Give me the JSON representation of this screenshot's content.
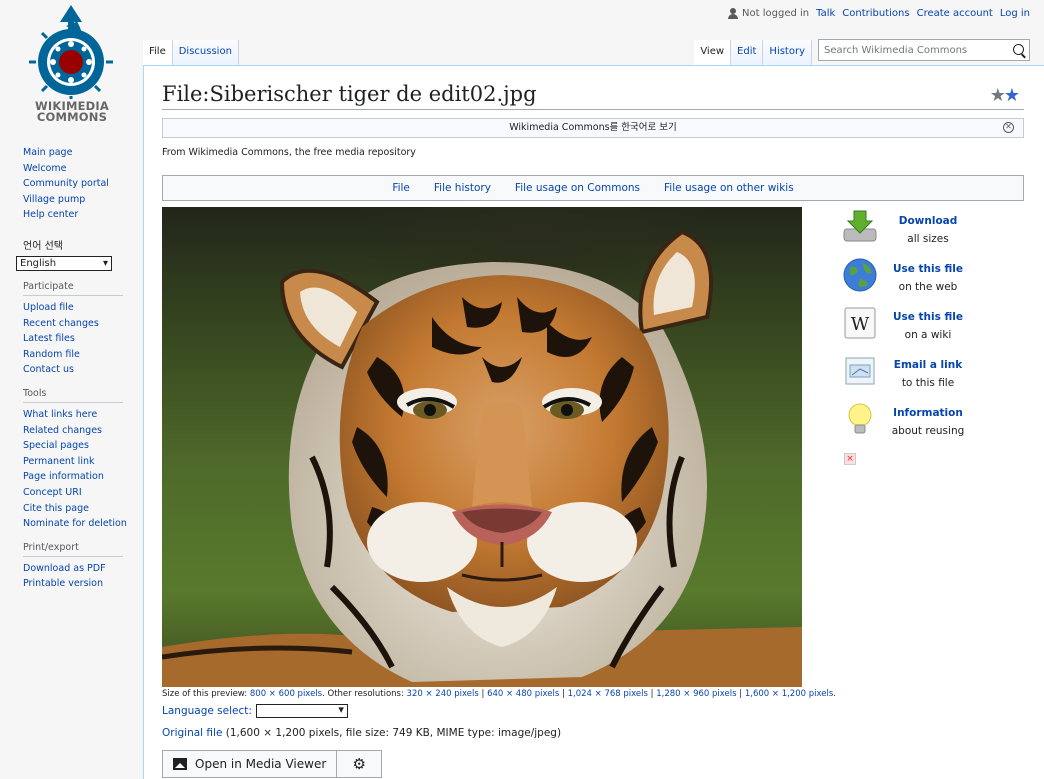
{
  "personal": {
    "not_logged_in": "Not logged in",
    "talk": "Talk",
    "contributions": "Contributions",
    "create_account": "Create account",
    "log_in": "Log in"
  },
  "logo": {
    "line1": "WIKIMEDIA",
    "line2": "COMMONS",
    "icon": "wikimedia-commons-logo"
  },
  "sidebar": {
    "nav": [
      "Main page",
      "Welcome",
      "Community portal",
      "Village pump",
      "Help center"
    ],
    "language_heading": "언어 선택",
    "language_value": "English",
    "participate_heading": "Participate",
    "participate": [
      "Upload file",
      "Recent changes",
      "Latest files",
      "Random file",
      "Contact us"
    ],
    "tools_heading": "Tools",
    "tools": [
      "What links here",
      "Related changes",
      "Special pages",
      "Permanent link",
      "Page information",
      "Concept URI",
      "Cite this page",
      "Nominate for deletion"
    ],
    "print_heading": "Print/export",
    "print": [
      "Download as PDF",
      "Printable version"
    ]
  },
  "tabs": {
    "file": "File",
    "discussion": "Discussion",
    "view": "View",
    "edit": "Edit",
    "history": "History"
  },
  "search": {
    "placeholder": "Search Wikimedia Commons"
  },
  "page": {
    "title": "File:Siberischer tiger de edit02.jpg",
    "notice": "Wikimedia Commons를 한국어로 보기",
    "tagline": "From Wikimedia Commons, the free media repository",
    "toc": [
      "File",
      "File history",
      "File usage on Commons",
      "File usage on other wikis"
    ]
  },
  "actions": [
    {
      "main": "Download",
      "sub": "all sizes",
      "icon": "download-icon"
    },
    {
      "main": "Use this file",
      "sub": "on the web",
      "icon": "globe-icon"
    },
    {
      "main": "Use this file",
      "sub": "on a wiki",
      "icon": "wikipedia-icon"
    },
    {
      "main": "Email a link",
      "sub": "to this file",
      "icon": "email-icon"
    },
    {
      "main": "Information",
      "sub": "about reusing",
      "icon": "lightbulb-icon"
    }
  ],
  "sizes": {
    "prefix": "Size of this preview: ",
    "preview": "800 × 600 pixels",
    "other": ". Other resolutions: ",
    "r1": "320 × 240 pixels",
    "r2": "640 × 480 pixels",
    "r3": "1,024 × 768 pixels",
    "r4": "1,280 × 960 pixels",
    "r5": "1,600 × 1,200 pixels",
    "sep": " | ",
    "end": "."
  },
  "language_select": {
    "label": "Language select:"
  },
  "original": {
    "link": "Original file",
    "details": " (1,600 × 1,200 pixels, file size: 749 KB, MIME type: image/jpeg)"
  },
  "mmv": {
    "open": "Open in Media Viewer",
    "settings_icon": "gear-icon"
  }
}
